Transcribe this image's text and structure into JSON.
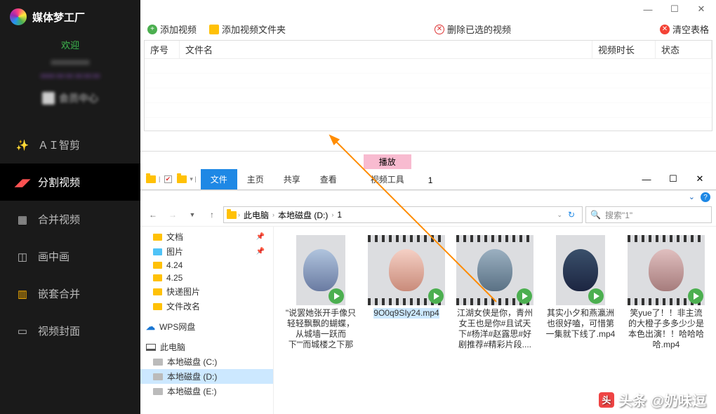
{
  "app": {
    "title": "媒体梦工厂"
  },
  "user": {
    "name": "欢迎",
    "info1": "xxxxxxxxxx",
    "info2": "xxxx-xx-xx xx:xx:xx",
    "member": "会员中心"
  },
  "nav": [
    {
      "label": "ＡＩ智剪"
    },
    {
      "label": "分割视频"
    },
    {
      "label": "合并视频"
    },
    {
      "label": "画中画"
    },
    {
      "label": "嵌套合并"
    },
    {
      "label": "视频封面"
    }
  ],
  "toolbar": {
    "add_video": "添加视频",
    "add_folder": "添加视频文件夹",
    "del_selected": "删除已选的视频",
    "clear_table": "清空表格"
  },
  "grid": {
    "col_index": "序号",
    "col_filename": "文件名",
    "col_duration": "视频时长",
    "col_status": "状态"
  },
  "explorer": {
    "ribbon": {
      "file": "文件",
      "home": "主页",
      "share": "共享",
      "view": "查看",
      "video_tools": "视频工具",
      "play": "播放"
    },
    "folder_num": "1",
    "crumbs": {
      "pc": "此电脑",
      "drive": "本地磁盘 (D:)",
      "folder": "1"
    },
    "search_placeholder": "搜索\"1\"",
    "tree": {
      "docs": "文档",
      "pics": "图片",
      "f1": "4.24",
      "f2": "4.25",
      "f3": "快递图片",
      "f4": "文件改名",
      "wps": "WPS网盘",
      "pc": "此电脑",
      "d1": "本地磁盘 (C:)",
      "d2": "本地磁盘 (D:)",
      "d3": "本地磁盘 (E:)"
    },
    "files": [
      {
        "name": "\"说罢她张开手像只轻轻飘飘的蝴蝶，从城墙一跃而下\"\"而城楼之下那个玄衣的身影...."
      },
      {
        "name": "9O0q9SIy24.mp4"
      },
      {
        "name": "江湖女侠是你，青州女王也是你#且试天下#杨洋#赵露思#好剧推荐#精彩片段...."
      },
      {
        "name": "其实小夕和燕瀛洲也很好嗑，可惜第一集就下线了.mp4"
      },
      {
        "name": "笑yue了！！非主流的大橙子多多少少是本色出演！！哈哈哈哈.mp4"
      }
    ]
  },
  "watermark": "头条 @奶味逗"
}
